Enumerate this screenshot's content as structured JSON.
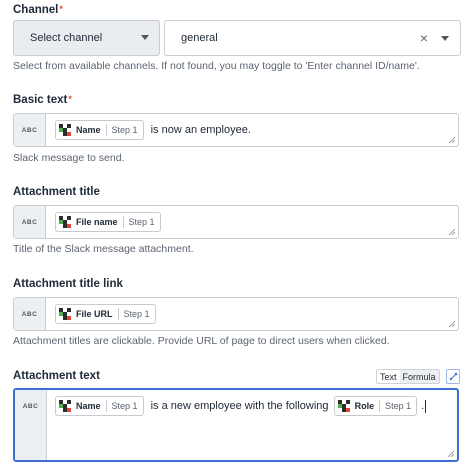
{
  "channel": {
    "label": "Channel",
    "required_mark": "*",
    "select_label": "Select channel",
    "value": "general",
    "clear_symbol": "×",
    "hint": "Select from available channels. If not found, you may toggle to 'Enter channel ID/name'."
  },
  "basic_text": {
    "label": "Basic text",
    "required_mark": "*",
    "type_badge": "ABC",
    "pill_name": "Name",
    "pill_step": "Step 1",
    "text_after": " is now an employee.",
    "hint": "Slack message to send."
  },
  "attachment_title": {
    "label": "Attachment title",
    "type_badge": "ABC",
    "pill_name": "File name",
    "pill_step": "Step 1",
    "hint": "Title of the Slack message attachment."
  },
  "attachment_title_link": {
    "label": "Attachment title link",
    "type_badge": "ABC",
    "pill_name": "File URL",
    "pill_step": "Step 1",
    "hint": "Attachment titles are clickable. Provide URL of page to direct users when clicked."
  },
  "attachment_text": {
    "label": "Attachment text",
    "type_badge": "ABC",
    "mode_text": "Text",
    "mode_formula": "Formula",
    "pill1_name": "Name",
    "pill1_step": "Step 1",
    "text_mid": " is a new employee with the following ",
    "pill2_name": "Role",
    "pill2_step": "Step 1",
    "text_end": "."
  },
  "icons": {
    "pill": "app-logo-icon",
    "clear": "close-icon",
    "dropdown": "chevron-down-icon",
    "resize": "resize-handle-icon",
    "formula": "formula-icon"
  },
  "colors": {
    "required": "#e04a3f",
    "focus": "#3b6fd4"
  }
}
